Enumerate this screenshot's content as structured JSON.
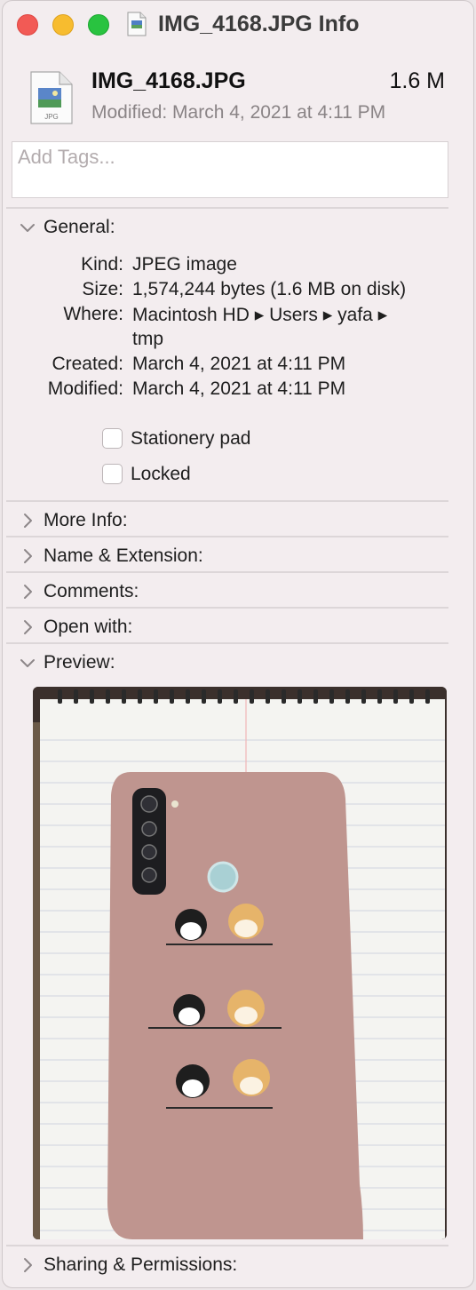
{
  "window": {
    "title": "IMG_4168.JPG Info"
  },
  "header": {
    "filename": "IMG_4168.JPG",
    "size": "1.6 M",
    "modified": "Modified: March 4, 2021 at 4:11 PM",
    "icon_badge": "JPG"
  },
  "tags": {
    "placeholder": "Add Tags..."
  },
  "general": {
    "label": "General:",
    "rows": [
      {
        "label": "Kind:",
        "value": "JPEG image"
      },
      {
        "label": "Size:",
        "value": "1,574,244 bytes (1.6 MB on disk)"
      },
      {
        "label": "Where:",
        "value": "Macintosh HD ▸ Users ▸ yafa ▸",
        "value2": "tmp"
      },
      {
        "label": "Created:",
        "value": "March 4, 2021 at 4:11 PM"
      },
      {
        "label": "Modified:",
        "value": "March 4, 2021 at 4:11 PM"
      }
    ],
    "stationery": {
      "label": "Stationery pad",
      "checked": false
    },
    "locked": {
      "label": "Locked",
      "checked": false
    }
  },
  "sections": {
    "more_info": "More Info:",
    "name_extension": "Name & Extension:",
    "comments": "Comments:",
    "open_with": "Open with:",
    "preview": "Preview:",
    "sharing": "Sharing & Permissions:"
  },
  "icons": {
    "close": "close-icon",
    "minimize": "minimize-icon",
    "zoom": "zoom-icon",
    "expanded": "chevron-down-icon",
    "collapsed": "chevron-right-icon"
  },
  "colors": {
    "window_bg": "#f3edef",
    "close": "#f25a55",
    "minimize": "#f7bc2f",
    "zoom": "#29c340",
    "secondary_text": "#8a8486",
    "phone_case": "#bf958f"
  }
}
